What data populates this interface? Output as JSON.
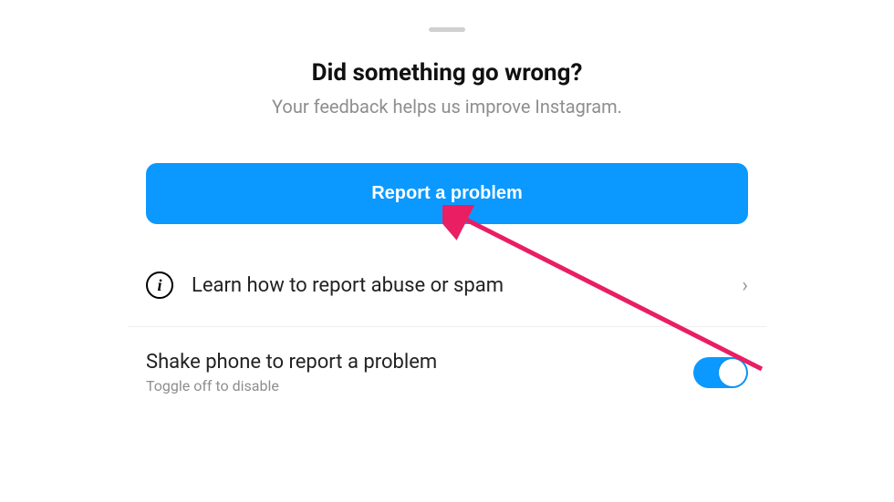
{
  "header": {
    "title": "Did something go wrong?",
    "subtitle": "Your feedback helps us improve Instagram."
  },
  "primary_button": {
    "label": "Report a problem"
  },
  "learn_row": {
    "label": "Learn how to report abuse or spam"
  },
  "shake_toggle": {
    "title": "Shake phone to report a problem",
    "subtitle": "Toggle off to disable",
    "on": true
  },
  "icons": {
    "info_glyph": "i",
    "chevron_right": "›"
  }
}
